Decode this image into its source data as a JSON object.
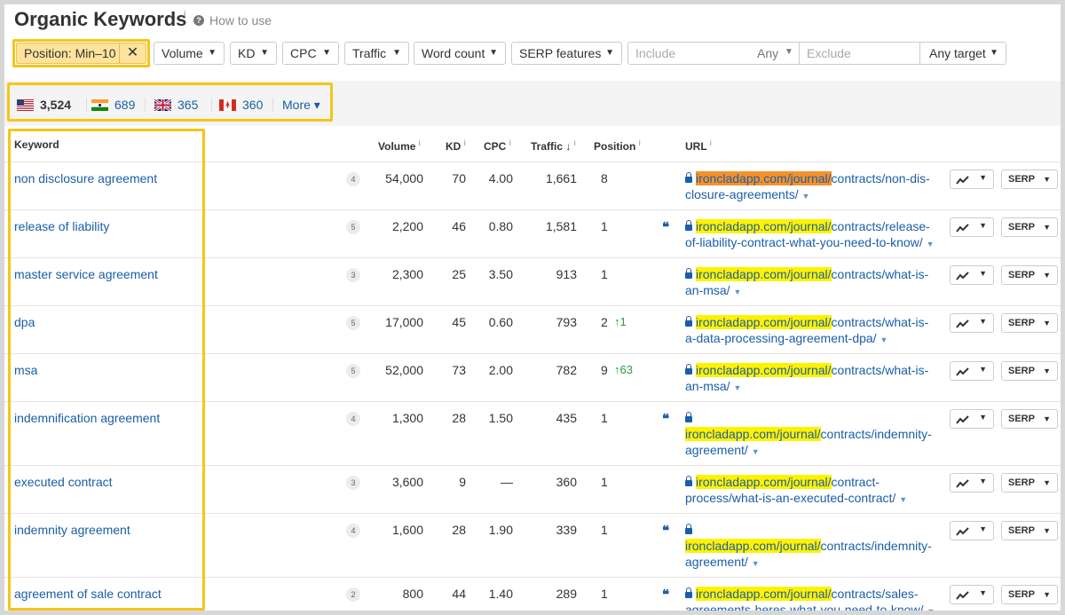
{
  "header": {
    "title": "Organic Keywords",
    "title_info": "i",
    "help_icon_glyph": "?",
    "how_to_use": "How to use"
  },
  "filters": {
    "position": "Position: Min–10",
    "position_close": "✕",
    "volume": "Volume",
    "kd": "KD",
    "cpc": "CPC",
    "traffic": "Traffic",
    "word_count": "Word count",
    "serp_features": "SERP features",
    "include_placeholder": "Include",
    "any": "Any",
    "exclude_placeholder": "Exclude",
    "any_target": "Any target",
    "caret": "▼"
  },
  "countries": [
    {
      "flag": "us-flag",
      "count": "3,524"
    },
    {
      "flag": "in-flag",
      "count": "689"
    },
    {
      "flag": "gb-flag",
      "count": "365"
    },
    {
      "flag": "ca-flag",
      "count": "360"
    }
  ],
  "more": "More ▾",
  "table": {
    "headers": {
      "keyword": "Keyword",
      "volume": "Volume",
      "kd": "KD",
      "cpc": "CPC",
      "traffic": "Traffic",
      "traffic_sort": "↓",
      "position": "Position",
      "url": "URL",
      "info": "i"
    },
    "rows": [
      {
        "keyword": "non disclosure agreement",
        "words": "4",
        "volume": "54,000",
        "kd": "70",
        "cpc": "4.00",
        "traffic": "1,661",
        "position": "8",
        "change": "",
        "quote": "",
        "url_domain": "ironcladapp.com/journal/",
        "url_path_1": "contracts/non-dis-",
        "url_path_2": "closure-agreements/"
      },
      {
        "keyword": "release of liability",
        "words": "5",
        "volume": "2,200",
        "kd": "46",
        "cpc": "0.80",
        "traffic": "1,581",
        "position": "1",
        "change": "",
        "quote": "❝",
        "url_domain": "ironcladapp.com/journal/",
        "url_path_1": "contracts/release-",
        "url_path_2": "of-liability-contract-what-you-need-to-know/"
      },
      {
        "keyword": "master service agreement",
        "words": "3",
        "volume": "2,300",
        "kd": "25",
        "cpc": "3.50",
        "traffic": "913",
        "position": "1",
        "change": "",
        "quote": "",
        "url_domain": "ironcladapp.com/journal/",
        "url_path_1": "contracts/what-is-",
        "url_path_2": "an-msa/"
      },
      {
        "keyword": "dpa",
        "words": "5",
        "volume": "17,000",
        "kd": "45",
        "cpc": "0.60",
        "traffic": "793",
        "position": "2",
        "change": "↑1",
        "quote": "",
        "url_domain": "ironcladapp.com/journal/",
        "url_path_1": "contracts/what-is-",
        "url_path_2": "a-data-processing-agreement-dpa/"
      },
      {
        "keyword": "msa",
        "words": "5",
        "volume": "52,000",
        "kd": "73",
        "cpc": "2.00",
        "traffic": "782",
        "position": "9",
        "change": "↑63",
        "quote": "",
        "url_domain": "ironcladapp.com/journal/",
        "url_path_1": "contracts/what-is-",
        "url_path_2": "an-msa/"
      },
      {
        "keyword": "indemnification agreement",
        "words": "4",
        "volume": "1,300",
        "kd": "28",
        "cpc": "1.50",
        "traffic": "435",
        "position": "1",
        "change": "",
        "quote": "❝",
        "url_domain": "ironcladapp.com/journal/",
        "url_path_1": "contracts/indemnity-",
        "url_path_2": "agreement/"
      },
      {
        "keyword": "executed contract",
        "words": "3",
        "volume": "3,600",
        "kd": "9",
        "cpc": "—",
        "traffic": "360",
        "position": "1",
        "change": "",
        "quote": "",
        "url_domain": "ironcladapp.com/journal/",
        "url_path_1": "contract-",
        "url_path_2": "process/what-is-an-executed-contract/"
      },
      {
        "keyword": "indemnity agreement",
        "words": "4",
        "volume": "1,600",
        "kd": "28",
        "cpc": "1.90",
        "traffic": "339",
        "position": "1",
        "change": "",
        "quote": "❝",
        "url_domain": "ironcladapp.com/journal/",
        "url_path_1": "contracts/indemnity-",
        "url_path_2": "agreement/"
      },
      {
        "keyword": "agreement of sale contract",
        "words": "2",
        "volume": "800",
        "kd": "44",
        "cpc": "1.40",
        "traffic": "289",
        "position": "1",
        "change": "",
        "quote": "❝",
        "url_domain": "ironcladapp.com/journal/",
        "url_path_1": "contracts/sales-",
        "url_path_2": "agreements-heres-what-you-need-to-know/"
      }
    ],
    "serp_label": "SERP",
    "url_caret": "▼"
  },
  "colors": {
    "link": "#1a5ea8",
    "highlight_yellow": "#fff200",
    "highlight_orange": "#f5922b",
    "callout_border": "#f5c518",
    "positive_change": "#2a9d3c"
  }
}
